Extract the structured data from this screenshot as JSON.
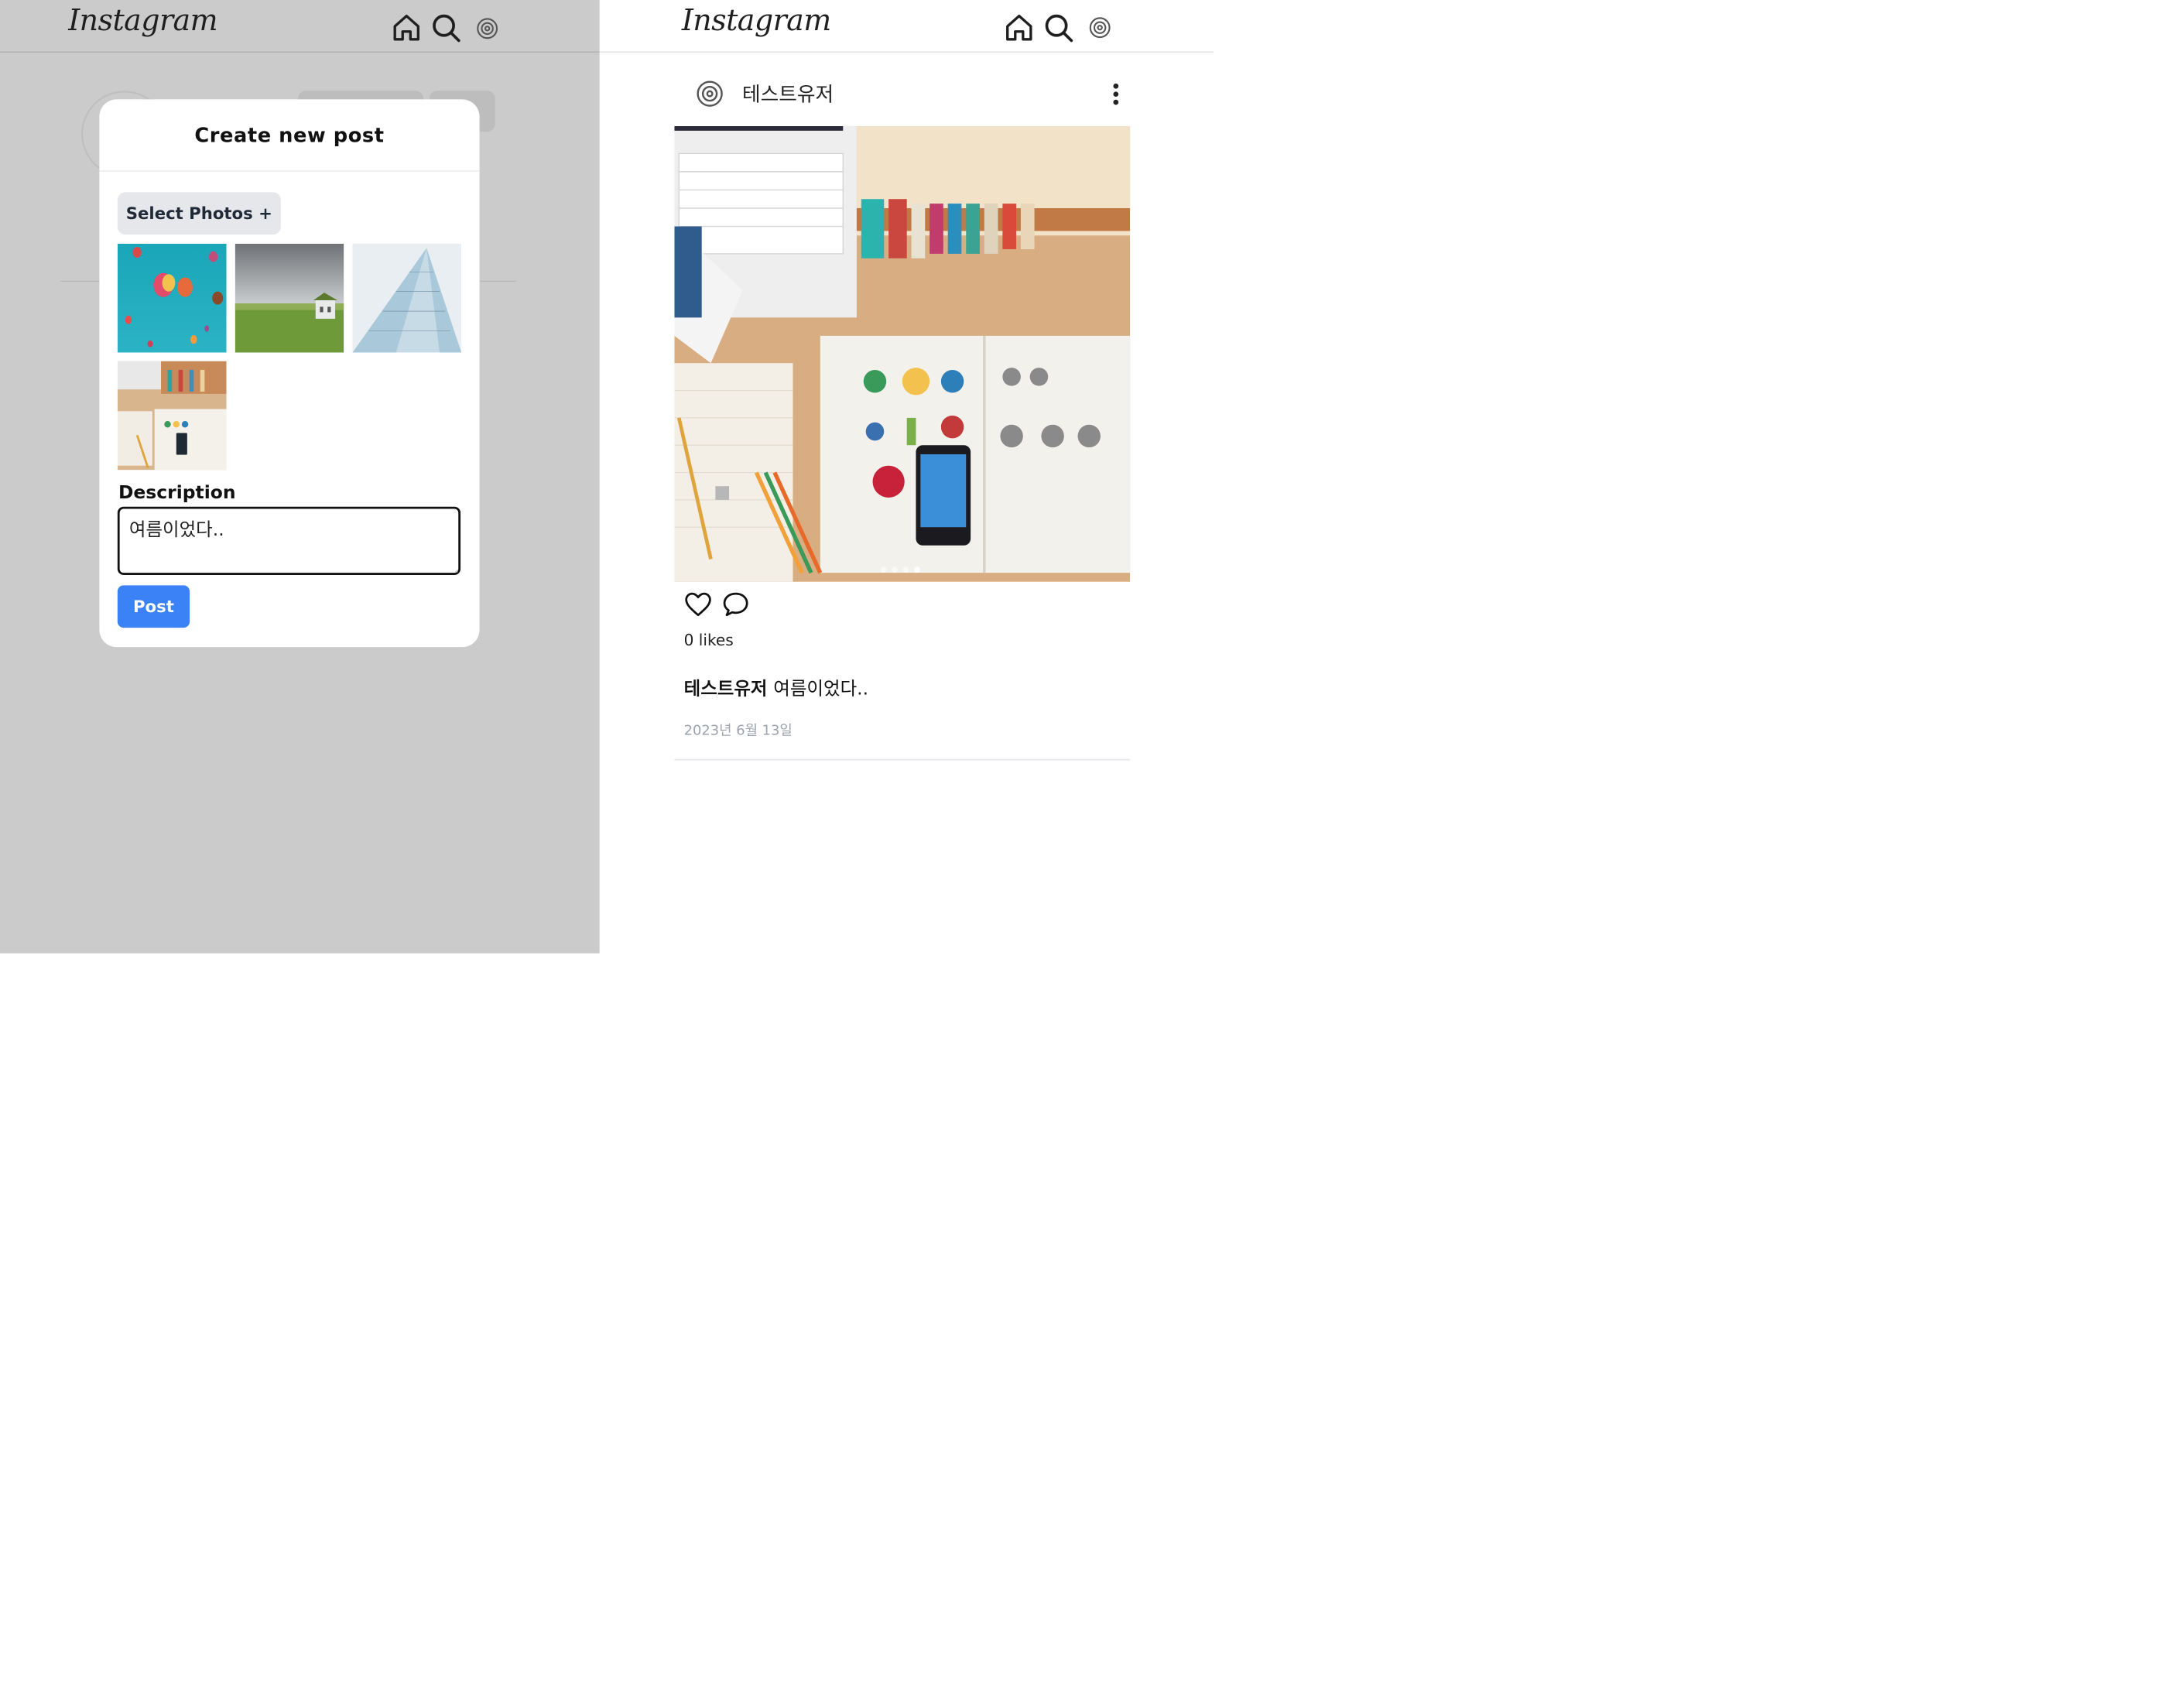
{
  "left": {
    "logo": "Instagram",
    "modal": {
      "title": "Create new post",
      "select_photos_label": "Select Photos +",
      "description_label": "Description",
      "description_value": "여름이었다..",
      "post_button_label": "Post",
      "thumbnails": [
        "hot-air-balloons",
        "field-house",
        "glass-building",
        "desk-study"
      ]
    }
  },
  "right": {
    "logo": "Instagram",
    "post": {
      "author": "테스트유저",
      "likes": "0 likes",
      "caption_author": "테스트유저",
      "caption_text": "여름이었다..",
      "date": "2023년 6월 13일",
      "carousel_count": 4,
      "carousel_active": 4
    }
  },
  "icons": {
    "home": "home-icon",
    "search": "search-icon",
    "profile": "profile-avatar-icon",
    "like": "heart-icon",
    "comment": "comment-icon",
    "more": "more-vertical-icon"
  },
  "colors": {
    "overlay_bg": "#cbcbcb",
    "primary_button": "#3b82f6",
    "secondary_button": "#e6e7eb"
  }
}
